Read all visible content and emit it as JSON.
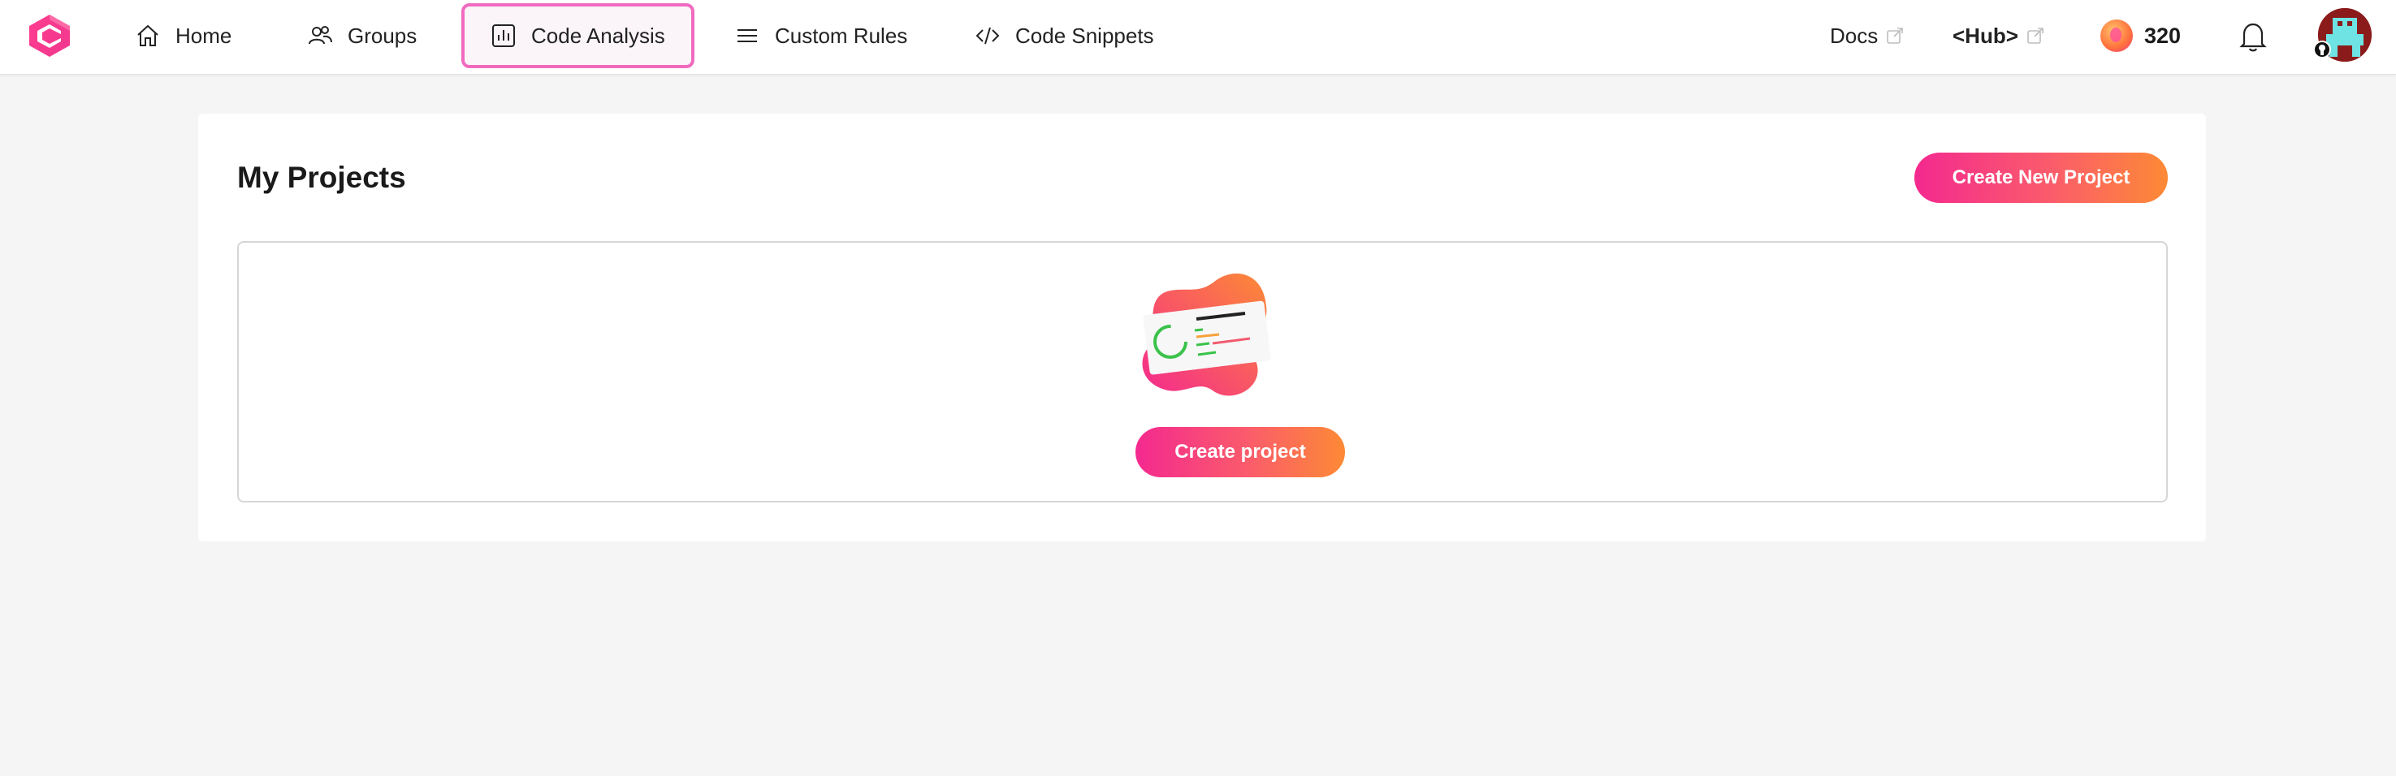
{
  "nav": {
    "items": [
      {
        "label": "Home",
        "icon": "home-icon"
      },
      {
        "label": "Groups",
        "icon": "users-icon"
      },
      {
        "label": "Code Analysis",
        "icon": "bar-chart-icon",
        "active": true
      },
      {
        "label": "Custom Rules",
        "icon": "menu-lines-icon"
      },
      {
        "label": "Code Snippets",
        "icon": "code-icon"
      }
    ],
    "docs": "Docs",
    "hub": "<Hub>",
    "points": "320"
  },
  "main": {
    "title": "My Projects",
    "create_new_label": "Create New Project",
    "create_project_label": "Create project"
  },
  "colors": {
    "accent_pink": "#f4298f",
    "accent_orange": "#fd8a35",
    "active_border": "#f06bbf"
  }
}
